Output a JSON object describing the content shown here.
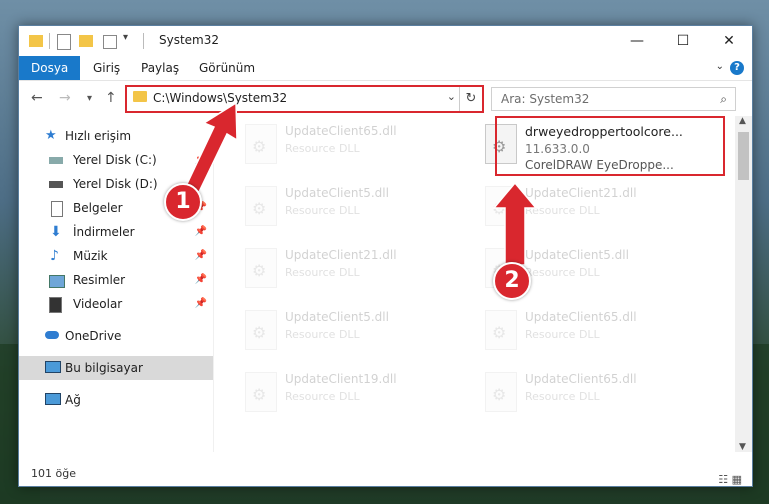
{
  "window": {
    "title": "System32"
  },
  "ribbon": {
    "tabs": [
      "Dosya",
      "Giriş",
      "Paylaş",
      "Görünüm"
    ]
  },
  "address": {
    "path": "C:\\Windows\\System32"
  },
  "search": {
    "placeholder": "Ara: System32"
  },
  "sidebar": {
    "items": [
      {
        "label": "Hızlı erişim",
        "icon": "star-icon"
      },
      {
        "label": "Yerel Disk (C:)",
        "icon": "drive-icon"
      },
      {
        "label": "Yerel Disk (D:)",
        "icon": "drive-icon"
      },
      {
        "label": "Belgeler",
        "icon": "documents-icon"
      },
      {
        "label": "İndirmeler",
        "icon": "download-icon"
      },
      {
        "label": "Müzik",
        "icon": "music-icon"
      },
      {
        "label": "Resimler",
        "icon": "pictures-icon"
      },
      {
        "label": "Videolar",
        "icon": "videos-icon"
      },
      {
        "label": "OneDrive",
        "icon": "cloud-icon"
      },
      {
        "label": "Bu bilgisayar",
        "icon": "computer-icon"
      },
      {
        "label": "Ağ",
        "icon": "network-icon"
      }
    ]
  },
  "files": {
    "highlighted": {
      "name": "drweyedroppertoolcore...",
      "version": "11.633.0.0",
      "desc": "CorelDRAW EyeDroppe..."
    },
    "left": [
      {
        "name": "UpdateClient65.dll",
        "type": "Resource DLL"
      },
      {
        "name": "UpdateClient5.dll",
        "type": "Resource DLL"
      },
      {
        "name": "UpdateClient21.dll",
        "type": "Resource DLL"
      },
      {
        "name": "UpdateClient5.dll",
        "type": "Resource DLL"
      },
      {
        "name": "UpdateClient19.dll",
        "type": "Resource DLL"
      }
    ],
    "right": [
      {
        "name": "UpdateClient21.dll",
        "type": "Resource DLL"
      },
      {
        "name": "UpdateClient5.dll",
        "type": "Resource DLL"
      },
      {
        "name": "UpdateClient65.dll",
        "type": "Resource DLL"
      },
      {
        "name": "UpdateClient65.dll",
        "type": "Resource DLL"
      }
    ]
  },
  "status": {
    "count": "101 öğe"
  },
  "annotations": {
    "badge1": "1",
    "badge2": "2"
  },
  "colors": {
    "accent": "#1979ca",
    "annotation": "#d9272e"
  }
}
